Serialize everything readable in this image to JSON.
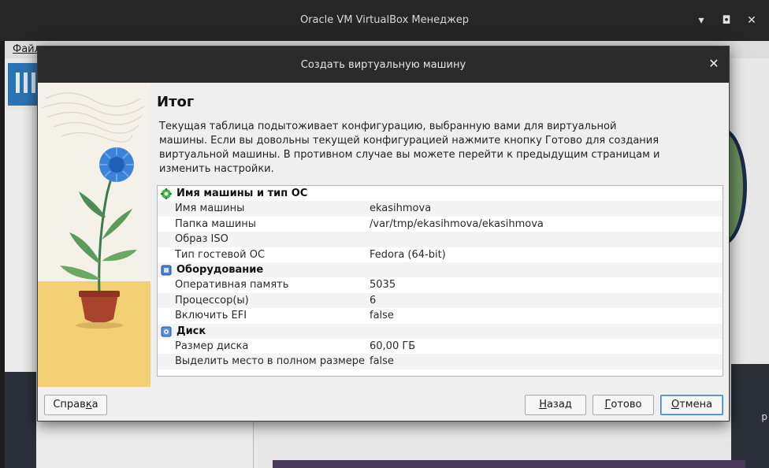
{
  "main_window": {
    "title": "Oracle VM VirtualBox Менеджер",
    "menu_first": "Файл",
    "controls": [
      "▾",
      "◘",
      "✕"
    ],
    "right_edge_text": "р"
  },
  "dialog": {
    "title": "Создать виртуальную машину",
    "close_icon": "✕",
    "heading": "Итог",
    "description": "Текущая таблица подытоживает конфигурацию, выбранную вами для виртуальной машины. Если вы довольны текущей конфигурацией нажмите кнопку Готово для создания виртуальной машины. В противном случае вы можете перейти к предыдущим страницам и изменить настройки.",
    "sections": [
      {
        "title": "Имя машины и тип ОС",
        "icon": "gear-green-icon",
        "rows": [
          {
            "label": "Имя машины",
            "value": "ekasihmova"
          },
          {
            "label": "Папка машины",
            "value": "/var/tmp/ekasihmova/ekasihmova"
          },
          {
            "label": "Образ ISO",
            "value": ""
          },
          {
            "label": "Тип гостевой ОС",
            "value": "Fedora (64-bit)"
          }
        ]
      },
      {
        "title": "Оборудование",
        "icon": "chip-icon",
        "rows": [
          {
            "label": "Оперативная память",
            "value": "5035"
          },
          {
            "label": "Процессор(ы)",
            "value": "6"
          },
          {
            "label": "Включить EFI",
            "value": "false"
          }
        ]
      },
      {
        "title": "Диск",
        "icon": "disk-icon",
        "rows": [
          {
            "label": "Размер диска",
            "value": "60,00 ГБ"
          },
          {
            "label": "Выделить место в полном размере",
            "value": "false"
          }
        ]
      }
    ],
    "buttons": {
      "help": {
        "pre": "Справ",
        "u": "к",
        "post": "а"
      },
      "back": {
        "pre": "",
        "u": "Н",
        "post": "азад"
      },
      "finish": {
        "pre": "",
        "u": "Г",
        "post": "отово"
      },
      "cancel": {
        "pre": "",
        "u": "О",
        "post": "тмена"
      }
    }
  },
  "colors": {
    "accent": "#3b7fc4",
    "titlebar": "#2b2b2b",
    "art_background": "#f2cf72"
  }
}
